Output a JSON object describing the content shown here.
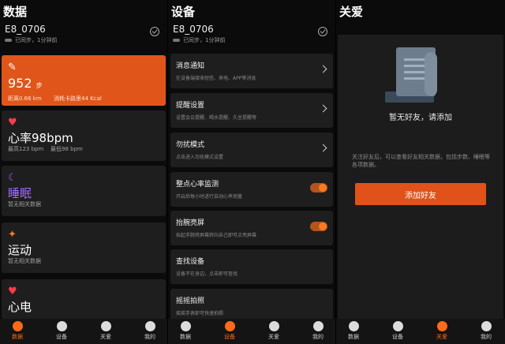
{
  "data_panel": {
    "title": "数据",
    "device": {
      "name": "E8_0706",
      "sync": "已同步，1分钟前"
    },
    "steps": {
      "value": "952",
      "unit": "步",
      "distance": "距离0.66 km",
      "calories": "消耗卡路里44 Kcal"
    },
    "heart_rate": {
      "value": "心率98bpm",
      "max": "最高123 bpm",
      "min": "最低98 bpm"
    },
    "sleep": {
      "title": "睡眠",
      "desc": "暂无相关数据"
    },
    "sport": {
      "title": "运动",
      "desc": "暂无相关数据"
    },
    "ecg": {
      "title": "心电"
    },
    "tabs": [
      "数据",
      "设备",
      "关爱",
      "我的"
    ],
    "active_tab": 0
  },
  "device_panel": {
    "title": "设备",
    "device": {
      "name": "E8_0706",
      "sync": "已同步，1分钟前"
    },
    "rows": [
      {
        "title": "消息通知",
        "desc": "在设备端接收短信、来电、APP等消息"
      },
      {
        "title": "提醒设置",
        "desc": "设置会议提醒、喝水提醒、久坐提醒等"
      },
      {
        "title": "勿扰模式",
        "desc": "点击进入勿扰模式设置"
      },
      {
        "title": "整点心率监测",
        "desc": "开启后每小时进行自动心率测量",
        "on": true
      },
      {
        "title": "抬腕亮屏",
        "desc": "抬起手腕将屏幕转向自己即可点亮屏幕",
        "on": true
      },
      {
        "title": "查找设备",
        "desc": "设备不在身边，点击即可查找"
      },
      {
        "title": "摇摇拍照",
        "desc": "摇摇手表即可快速拍照"
      }
    ],
    "tabs": [
      "数据",
      "设备",
      "关爱",
      "我的"
    ],
    "active_tab": 1
  },
  "care_panel": {
    "title": "关爱",
    "empty_title": "暂无好友，请添加",
    "desc": "关注好友后，可以查看好友相关数据，包括步数、睡眠等各项数据。",
    "add_button": "添加好友",
    "tabs": [
      "数据",
      "设备",
      "关爱",
      "我的"
    ],
    "active_tab": 2
  },
  "colors": {
    "accent": "#e0561a",
    "card": "#1e1e1e",
    "background": "#0b0b0b"
  }
}
